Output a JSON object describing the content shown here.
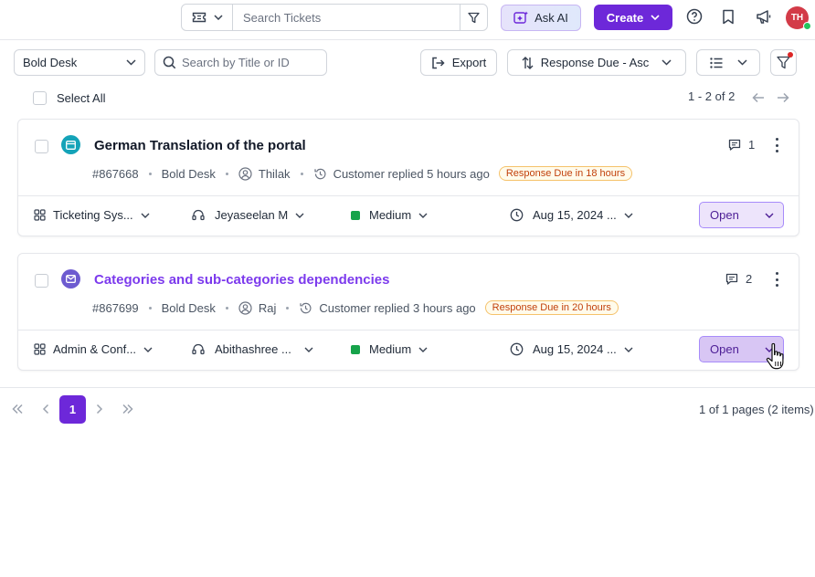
{
  "header": {
    "search_placeholder": "Search Tickets",
    "ask_ai_label": "Ask AI",
    "create_label": "Create",
    "avatar_initials": "TH"
  },
  "toolbar": {
    "brand_select": "Bold Desk",
    "title_search_placeholder": "Search by Title or ID",
    "export_label": "Export",
    "sort_label": "Response Due - Asc",
    "select_all_label": "Select All",
    "range_label": "1 - 2 of 2"
  },
  "tickets": [
    {
      "title": "German Translation of the portal",
      "id": "#867668",
      "brand": "Bold Desk",
      "requester": "Thilak",
      "activity": "Customer replied 5 hours ago",
      "due": "Response Due in 18 hours",
      "comment_count": "1",
      "category": "Ticketing Sys...",
      "agent": "Jeyaseelan M",
      "priority": "Medium",
      "date": "Aug 15, 2024 ...",
      "status": "Open",
      "source_icon": "portal-icon"
    },
    {
      "title": "Categories and sub-categories dependencies",
      "id": "#867699",
      "brand": "Bold Desk",
      "requester": "Raj",
      "activity": "Customer replied 3 hours ago",
      "due": "Response Due in 20 hours",
      "comment_count": "2",
      "category": "Admin & Conf...",
      "agent": "Abithashree ...",
      "priority": "Medium",
      "date": "Aug 15, 2024 ...",
      "status": "Open",
      "source_icon": "email-icon"
    }
  ],
  "pagination": {
    "current_page": "1",
    "info": "1 of 1 pages (2 items)"
  },
  "colors": {
    "accent": "#6d28d9",
    "priority_medium": "#16a34a",
    "due_text": "#c2410c",
    "portal_icon_bg": "#14a3b8",
    "email_icon_bg": "#6d5bd0",
    "avatar_bg": "#d33b48"
  }
}
